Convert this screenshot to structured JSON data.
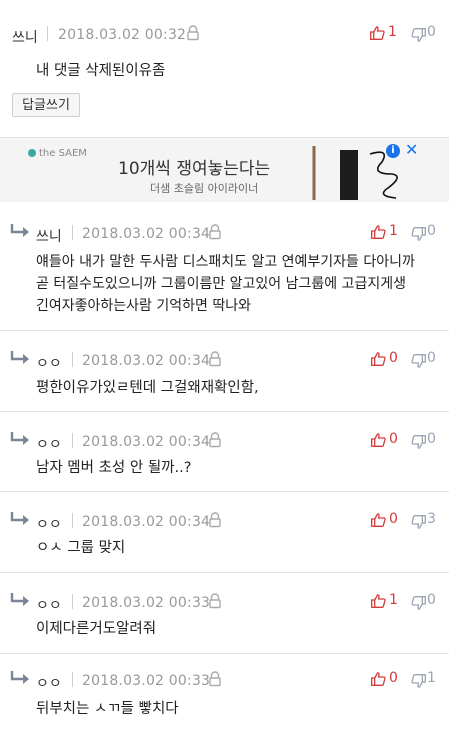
{
  "comments": [
    {
      "nickname": "쓰니",
      "date": "2018.03.02 00:32",
      "likes": "1",
      "dislikes": "0",
      "text": [
        "내 댓글 삭제된이유좀"
      ],
      "reply_button": "답글쓰기"
    },
    {
      "nickname": "쓰니",
      "date": "2018.03.02 00:34",
      "likes": "1",
      "dislikes": "0",
      "text": [
        "얘들아 내가 말한 두사람 디스패치도 알고 연예부기자들 다아니까",
        "곧 터질수도있으니까 그룹이름만 알고있어 남그룹에 고급지게생",
        "긴여자좋아하는사람 기억하면 딱나와"
      ]
    },
    {
      "nickname": "ㅇㅇ",
      "date": "2018.03.02 00:34",
      "likes": "0",
      "dislikes": "0",
      "text": [
        "평한이유가있ㄹ텐데 그걸왜재확인함,"
      ]
    },
    {
      "nickname": "ㅇㅇ",
      "date": "2018.03.02 00:34",
      "likes": "0",
      "dislikes": "0",
      "text": [
        "남자 멤버 초성 안 될까..?"
      ]
    },
    {
      "nickname": "ㅇㅇ",
      "date": "2018.03.02 00:34",
      "likes": "0",
      "dislikes": "3",
      "text": [
        "ㅇㅅ 그룹 맞지"
      ]
    },
    {
      "nickname": "ㅇㅇ",
      "date": "2018.03.02 00:33",
      "likes": "1",
      "dislikes": "0",
      "text": [
        "이제다른거도알려줘"
      ]
    },
    {
      "nickname": "ㅇㅇ",
      "date": "2018.03.02 00:33",
      "likes": "0",
      "dislikes": "1",
      "text": [
        "뒤부치는 ㅅㄲ들 빻치다"
      ]
    }
  ],
  "ad": {
    "brand": "the SAEM",
    "headline": "10개씩 쟁여놓는다는",
    "subline": "더샘 초슬림 아이라이너",
    "info_label": "i",
    "close_label": "✕"
  },
  "colors": {
    "like": "#d33a3a",
    "dislike": "#9aa4b4",
    "date": "#999999",
    "border": "#e3e3e3"
  },
  "icons": {
    "reply_arrow": "reply-arrow-icon",
    "lock": "lock-icon",
    "like": "thumbs-up-icon",
    "dislike": "thumbs-down-icon"
  }
}
